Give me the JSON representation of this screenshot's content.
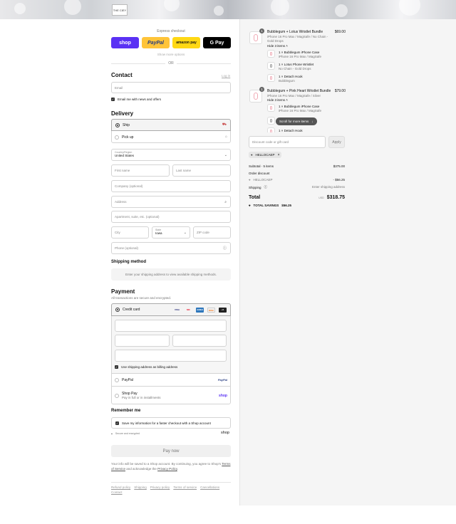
{
  "banner": {
    "logo_text": "THE CIEY"
  },
  "express": {
    "title": "Express checkout",
    "buttons": [
      "shop",
      "PayPal",
      "amazon pay",
      "G Pay"
    ],
    "show_more": "Show more options",
    "or": "OR"
  },
  "contact": {
    "heading": "Contact",
    "login": "Log in",
    "email_placeholder": "Email",
    "news_label": "Email me with news and offers"
  },
  "delivery": {
    "heading": "Delivery",
    "options": [
      "Ship",
      "Pick up"
    ],
    "country_label": "Country/Region",
    "country_value": "United States",
    "first_name": "First name",
    "last_name": "Last name",
    "company": "Company (optional)",
    "address": "Address",
    "apartment": "Apartment, suite, etc. (optional)",
    "city": "City",
    "state_label": "State",
    "state_value": "Iowa",
    "zip": "ZIP code",
    "phone": "Phone (optional)"
  },
  "shipping_method": {
    "heading": "Shipping method",
    "note": "Enter your shipping address to view available shipping methods."
  },
  "payment": {
    "heading": "Payment",
    "subtitle": "All transactions are secure and encrypted.",
    "credit_card": "Credit card",
    "card_brands": [
      "VISA",
      "MC",
      "AMEX",
      "DISC",
      "+5"
    ],
    "billing_label": "Use shipping address as billing address",
    "paypal": "PayPal",
    "shop_pay": "Shop Pay",
    "shop_pay_sub": "Pay in full or in installments"
  },
  "remember": {
    "heading": "Remember me",
    "save_label": "Save my information for a faster checkout with a Shop account",
    "secure": "Secure and encrypted",
    "shop": "shop"
  },
  "pay_now": "Pay now",
  "legal": {
    "text_1": "Your info will be saved to a Shop account. By continuing, you agree to Shop's",
    "terms": "Terms of Service",
    "text_2": "and acknowledge the",
    "privacy": "Privacy Policy",
    "text_3": "."
  },
  "footer_links": [
    "Refund policy",
    "Shipping",
    "Privacy policy",
    "Terms of service",
    "Cancellations",
    "Contact"
  ],
  "cart": {
    "items": [
      {
        "qty": "1",
        "title": "Bubblegum + Lotus Wristlet Bundle",
        "variant": "iPhone 16 Pro Max / MagSafe / No Chain - Gold Drops",
        "price": "$69.00",
        "hide": "Hide 3 items",
        "sub": [
          {
            "title": "1 × Bubblegum iPhone Case",
            "variant": "iPhone 16 Pro Max / MagSafe"
          },
          {
            "title": "1 × Lotus Phone Wristlet",
            "variant": "No Chain - Gold Drops"
          },
          {
            "title": "1 × Detach Hook",
            "variant": "Bubblegum"
          }
        ]
      },
      {
        "qty": "1",
        "title": "Bubblegum + Pink Heart Wristlet Bundle",
        "variant": "iPhone 16 Pro Max / MagSafe / Silver",
        "price": "$79.00",
        "hide": "Hide 3 items",
        "sub": [
          {
            "title": "1 × Bubblegum iPhone Case",
            "variant": "iPhone 16 Pro Max / MagSafe"
          },
          {
            "title": "1 × Detach Hook",
            "variant": ""
          }
        ]
      }
    ],
    "scroll_hint": "Scroll for more items",
    "discount_placeholder": "Discount code or gift card",
    "apply": "Apply",
    "applied_code": "HELLOCAEP",
    "subtotal_label": "Subtotal · 5 items",
    "subtotal_value": "$375.00",
    "order_discount": "Order discount",
    "discount_code": "HELLOCAEP",
    "discount_value": "- $56.25",
    "shipping_label": "Shipping",
    "shipping_value": "Enter shipping address",
    "total_label": "Total",
    "currency": "USD",
    "total_value": "$318.75",
    "savings_label": "TOTAL SAVINGS",
    "savings_value": "$56.25"
  },
  "colors": {
    "shop": "#5a31f4",
    "paypal": "#ffc439",
    "amazon": "#ffd814",
    "gpay": "#000000"
  }
}
